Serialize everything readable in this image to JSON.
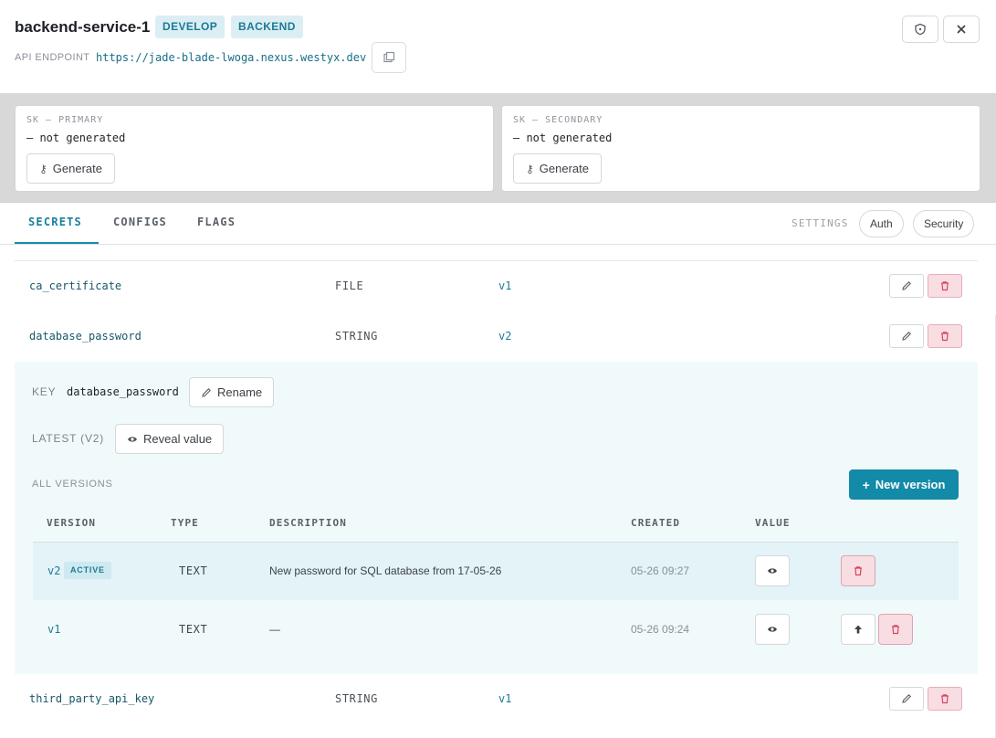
{
  "header": {
    "title": "backend-service-1",
    "badges": [
      "DEVELOP",
      "BACKEND"
    ],
    "api_label": "API ENDPOINT",
    "api_url": "https://jade-blade-lwoga.nexus.westyx.dev"
  },
  "sk": [
    {
      "label": "SK — PRIMARY",
      "value": "— not generated",
      "button": "Generate"
    },
    {
      "label": "SK — SECONDARY",
      "value": "— not generated",
      "button": "Generate"
    }
  ],
  "tabs": [
    {
      "label": "SECRETS",
      "active": true
    },
    {
      "label": "CONFIGS",
      "active": false
    },
    {
      "label": "FLAGS",
      "active": false
    }
  ],
  "settings": {
    "label": "SETTINGS",
    "buttons": [
      "Auth",
      "Security"
    ]
  },
  "secrets": [
    {
      "key": "ca_certificate",
      "type": "FILE",
      "version": "v1"
    },
    {
      "key": "database_password",
      "type": "STRING",
      "version": "v2"
    },
    {
      "key": "third_party_api_key",
      "type": "STRING",
      "version": "v1"
    }
  ],
  "expanded": {
    "key_label": "KEY",
    "key_value": "database_password",
    "rename_label": "Rename",
    "latest_label": "LATEST (V2)",
    "reveal_label": "Reveal value",
    "all_versions_label": "ALL VERSIONS",
    "new_version_label": "New version",
    "columns": [
      "VERSION",
      "TYPE",
      "DESCRIPTION",
      "CREATED",
      "VALUE"
    ],
    "versions": [
      {
        "version": "v2",
        "badge": "ACTIVE",
        "type": "TEXT",
        "description": "New password for SQL database from 17-05-26",
        "created": "05-26 09:27"
      },
      {
        "version": "v1",
        "badge": "",
        "type": "TEXT",
        "description": "—",
        "created": "05-26 09:24"
      }
    ]
  },
  "colors": {
    "accent": "#138aa7",
    "danger": "#d9455f",
    "badge_bg": "#dbeef4"
  }
}
